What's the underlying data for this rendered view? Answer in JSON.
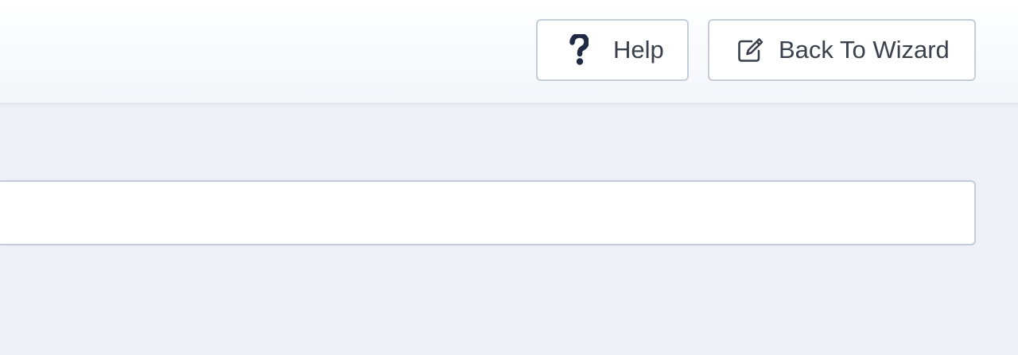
{
  "toolbar": {
    "help_button": {
      "label": "Help",
      "icon": "question-mark-icon"
    },
    "back_to_wizard_button": {
      "label": "Back To Wizard",
      "icon": "edit-icon"
    }
  },
  "main": {
    "text_field": {
      "value": "",
      "placeholder": ""
    }
  },
  "colors": {
    "page_background": "#edf0f5",
    "toolbar_background": "#f3f6fa",
    "button_border": "#c7cdd6",
    "button_text": "#3a414c",
    "icon_dark": "#1f2a44",
    "field_border": "#c4cbdf"
  }
}
